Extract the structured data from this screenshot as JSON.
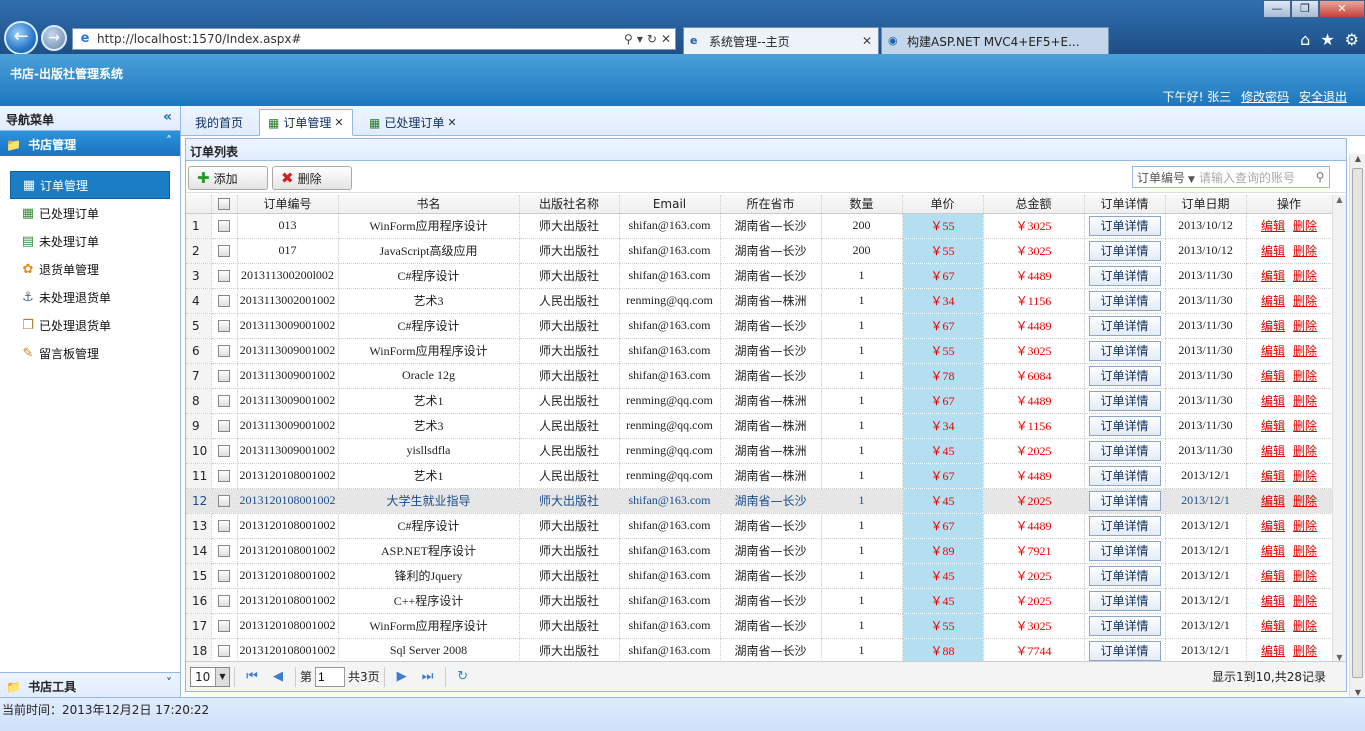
{
  "browser": {
    "url": "http://localhost:1570/Index.aspx#",
    "tabs": [
      {
        "label": "系统管理--主页"
      },
      {
        "label": "构建ASP.NET MVC4+EF5+E..."
      }
    ]
  },
  "app": {
    "title": "书店-出版社管理系统",
    "greeting": "下午好! 张三",
    "change_password": "修改密码",
    "logout": "安全退出"
  },
  "sidebar": {
    "header": "导航菜单",
    "section": "书店管理",
    "items": [
      {
        "label": "订单管理",
        "icon": "grid-icon"
      },
      {
        "label": "已处理订单",
        "icon": "table-icon"
      },
      {
        "label": "未处理订单",
        "icon": "list-icon"
      },
      {
        "label": "退货单管理",
        "icon": "gear-icon"
      },
      {
        "label": "未处理退货单",
        "icon": "anchor-icon"
      },
      {
        "label": "已处理退货单",
        "icon": "copy-icon"
      },
      {
        "label": "留言板管理",
        "icon": "edit-icon"
      }
    ],
    "footer": "书店工具"
  },
  "tabs": [
    {
      "label": "我的首页"
    },
    {
      "label": "订单管理"
    },
    {
      "label": "已处理订单"
    }
  ],
  "panel": {
    "title": "订单列表",
    "add_label": "添加",
    "delete_label": "删除",
    "search_field": "订单编号",
    "search_placeholder": "请输入查询的账号"
  },
  "grid": {
    "columns": [
      "订单编号",
      "书名",
      "出版社名称",
      "Email",
      "所在省市",
      "数量",
      "单价",
      "总金额",
      "订单详情",
      "订单日期",
      "操作"
    ],
    "detail_label": "订单详情",
    "edit_label": "编辑",
    "delete_label": "删除",
    "rows": [
      [
        "1",
        "013",
        "WinForm应用程序设计",
        "师大出版社",
        "shifan@163.com",
        "湖南省—长沙",
        "200",
        "￥55",
        "￥3025",
        "2013/10/12"
      ],
      [
        "2",
        "017",
        "JavaScript高级应用",
        "师大出版社",
        "shifan@163.com",
        "湖南省—长沙",
        "200",
        "￥55",
        "￥3025",
        "2013/10/12"
      ],
      [
        "3",
        "201311300200l002",
        "C#程序设计",
        "师大出版社",
        "shifan@163.com",
        "湖南省—长沙",
        "1",
        "￥67",
        "￥4489",
        "2013/11/30"
      ],
      [
        "4",
        "2013113002001002",
        "艺术3",
        "人民出版社",
        "renming@qq.com",
        "湖南省—株洲",
        "1",
        "￥34",
        "￥1156",
        "2013/11/30"
      ],
      [
        "5",
        "2013113009001002",
        "C#程序设计",
        "师大出版社",
        "shifan@163.com",
        "湖南省—长沙",
        "1",
        "￥67",
        "￥4489",
        "2013/11/30"
      ],
      [
        "6",
        "2013113009001002",
        "WinForm应用程序设计",
        "师大出版社",
        "shifan@163.com",
        "湖南省—长沙",
        "1",
        "￥55",
        "￥3025",
        "2013/11/30"
      ],
      [
        "7",
        "2013113009001002",
        "Oracle 12g",
        "师大出版社",
        "shifan@163.com",
        "湖南省—长沙",
        "1",
        "￥78",
        "￥6084",
        "2013/11/30"
      ],
      [
        "8",
        "2013113009001002",
        "艺术1",
        "人民出版社",
        "renming@qq.com",
        "湖南省—株洲",
        "1",
        "￥67",
        "￥4489",
        "2013/11/30"
      ],
      [
        "9",
        "2013113009001002",
        "艺术3",
        "人民出版社",
        "renming@qq.com",
        "湖南省—株洲",
        "1",
        "￥34",
        "￥1156",
        "2013/11/30"
      ],
      [
        "10",
        "2013113009001002",
        "yisllsdfla",
        "人民出版社",
        "renming@qq.com",
        "湖南省—株洲",
        "1",
        "￥45",
        "￥2025",
        "2013/11/30"
      ],
      [
        "11",
        "2013120108001002",
        "艺术1",
        "人民出版社",
        "renming@qq.com",
        "湖南省—株洲",
        "1",
        "￥67",
        "￥4489",
        "2013/12/1"
      ],
      [
        "12",
        "2013120108001002",
        "大学生就业指导",
        "师大出版社",
        "shifan@163.com",
        "湖南省—长沙",
        "1",
        "￥45",
        "￥2025",
        "2013/12/1"
      ],
      [
        "13",
        "2013120108001002",
        "C#程序设计",
        "师大出版社",
        "shifan@163.com",
        "湖南省—长沙",
        "1",
        "￥67",
        "￥4489",
        "2013/12/1"
      ],
      [
        "14",
        "2013120108001002",
        "ASP.NET程序设计",
        "师大出版社",
        "shifan@163.com",
        "湖南省—长沙",
        "1",
        "￥89",
        "￥7921",
        "2013/12/1"
      ],
      [
        "15",
        "2013120108001002",
        "锋利的Jquery",
        "师大出版社",
        "shifan@163.com",
        "湖南省—长沙",
        "1",
        "￥45",
        "￥2025",
        "2013/12/1"
      ],
      [
        "16",
        "2013120108001002",
        "C++程序设计",
        "师大出版社",
        "shifan@163.com",
        "湖南省—长沙",
        "1",
        "￥45",
        "￥2025",
        "2013/12/1"
      ],
      [
        "17",
        "2013120108001002",
        "WinForm应用程序设计",
        "师大出版社",
        "shifan@163.com",
        "湖南省—长沙",
        "1",
        "￥55",
        "￥3025",
        "2013/12/1"
      ],
      [
        "18",
        "2013120108001002",
        "Sql Server 2008",
        "师大出版社",
        "shifan@163.com",
        "湖南省—长沙",
        "1",
        "￥88",
        "￥7744",
        "2013/12/1"
      ]
    ]
  },
  "pager": {
    "page_size": "10",
    "page_prefix": "第",
    "page_value": "1",
    "page_total": "共3页",
    "info": "显示1到10,共28记录"
  },
  "status": {
    "time": "当前时间：2013年12月2日 17:20:22"
  },
  "colors": {
    "header_blue": "#1c77bd",
    "price_bg": "#b3dff0",
    "money_red": "#e00000"
  }
}
